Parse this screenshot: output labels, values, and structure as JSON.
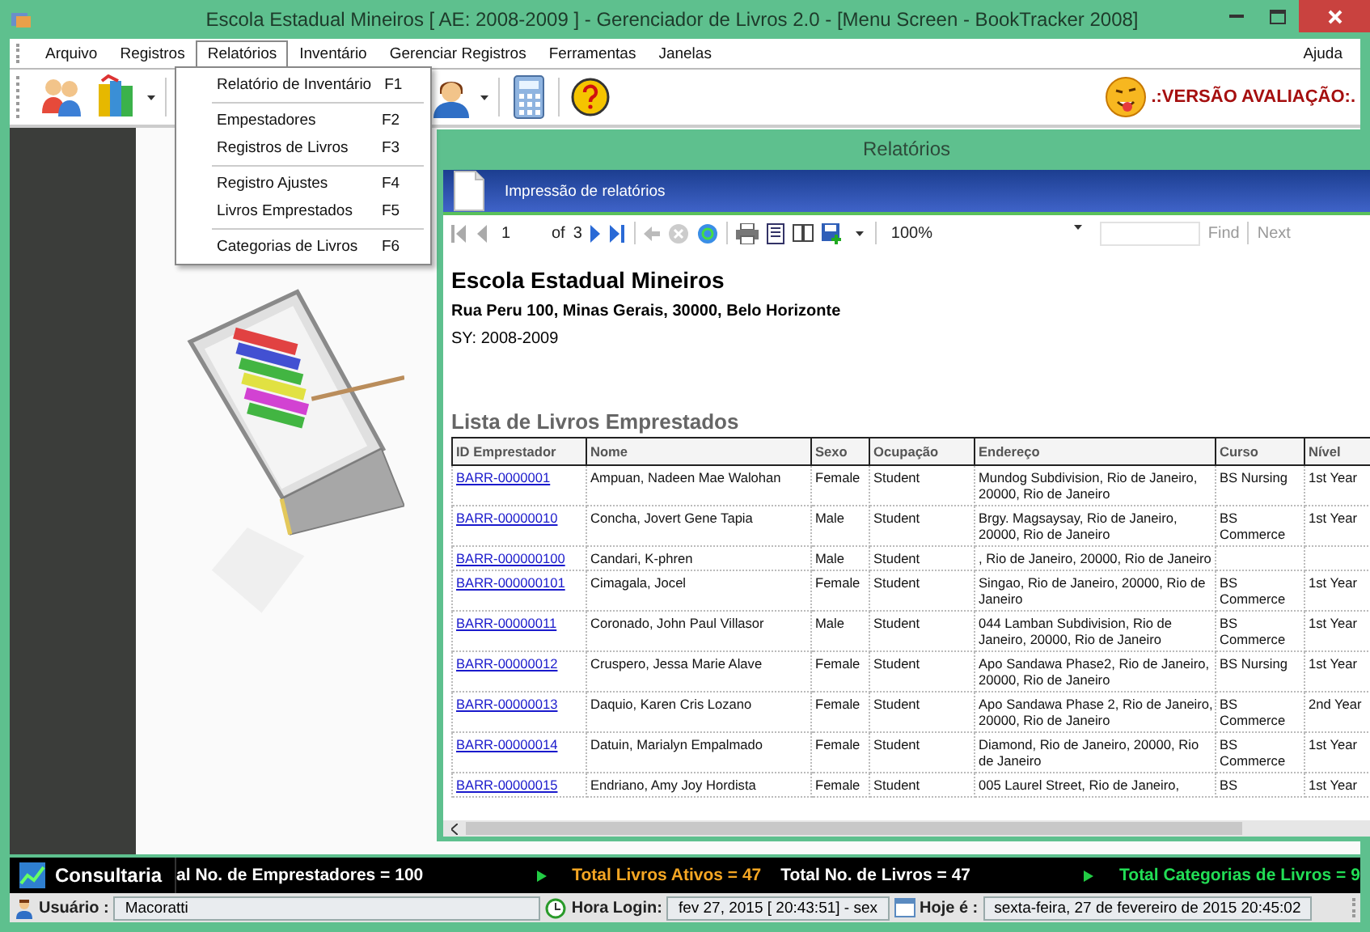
{
  "window": {
    "title": "Escola Estadual Mineiros [ AE: 2008-2009 ] - Gerenciador de Livros 2.0 - [Menu Screen - BookTracker 2008]"
  },
  "menu_bar": {
    "items": [
      {
        "label": "Arquivo",
        "selected": false
      },
      {
        "label": "Registros",
        "selected": false
      },
      {
        "label": "Relatórios",
        "selected": true
      },
      {
        "label": "Inventário",
        "selected": false
      },
      {
        "label": "Gerenciar Registros",
        "selected": false
      },
      {
        "label": "Ferramentas",
        "selected": false
      },
      {
        "label": "Janelas",
        "selected": false
      }
    ],
    "help": "Ajuda"
  },
  "open_menu": {
    "items": [
      {
        "kind": "option",
        "label": "Relatório de Inventário",
        "shortcut": "F1"
      },
      {
        "kind": "separator"
      },
      {
        "kind": "option",
        "label": "Empestadores",
        "shortcut": "F2"
      },
      {
        "kind": "option",
        "label": "Registros de Livros",
        "shortcut": "F3"
      },
      {
        "kind": "separator"
      },
      {
        "kind": "option",
        "label": "Registro Ajustes",
        "shortcut": "F4"
      },
      {
        "kind": "option",
        "label": "Livros Emprestados",
        "shortcut": "F5"
      },
      {
        "kind": "separator"
      },
      {
        "kind": "option",
        "label": "Categorias de Livros",
        "shortcut": "F6"
      }
    ]
  },
  "toolbar": {
    "badge": ".:VERSÃO AVALIAÇÃO:."
  },
  "report_window": {
    "title": "Relatórios",
    "header": "Impressão de relatórios",
    "viewer_toolbar": {
      "page": "1",
      "of": "of",
      "total_pages": "3",
      "zoom": "100%",
      "find": "Find",
      "next": "Next"
    },
    "report": {
      "school": "Escola Estadual Mineiros",
      "address": "Rua Peru 100, Minas Gerais, 30000, Belo Horizonte",
      "school_year": "SY: 2008-2009",
      "list_title": "Lista de Livros Emprestados",
      "columns": [
        "ID Emprestador",
        "Nome",
        "Sexo",
        "Ocupação",
        "Endereço",
        "Curso",
        "Nível"
      ],
      "rows": [
        [
          "BARR-0000001",
          "Ampuan, Nadeen Mae Walohan",
          "Female",
          "Student",
          "Mundog Subdivision, Rio de Janeiro, 20000, Rio de Janeiro",
          "BS Nursing",
          "1st Year"
        ],
        [
          "BARR-00000010",
          "Concha, Jovert Gene Tapia",
          "Male",
          "Student",
          "Brgy. Magsaysay, Rio de Janeiro, 20000, Rio de Janeiro",
          "BS Commerce",
          "1st Year"
        ],
        [
          "BARR-000000100",
          "Candari, K-phren",
          "Male",
          "Student",
          ", Rio de Janeiro, 20000, Rio de Janeiro",
          null,
          null
        ],
        [
          "BARR-000000101",
          "Cimagala, Jocel",
          "Female",
          "Student",
          "Singao, Rio de Janeiro, 20000, Rio de Janeiro",
          "BS Commerce",
          "1st Year"
        ],
        [
          "BARR-00000011",
          "Coronado, John Paul Villasor",
          "Male",
          "Student",
          "044 Lamban Subdivision, Rio de Janeiro, 20000, Rio de Janeiro",
          "BS Commerce",
          "1st Year"
        ],
        [
          "BARR-00000012",
          "Cruspero, Jessa Marie Alave",
          "Female",
          "Student",
          "Apo Sandawa Phase2, Rio de Janeiro, 20000, Rio de Janeiro",
          "BS Nursing",
          "1st Year"
        ],
        [
          "BARR-00000013",
          "Daquio, Karen Cris Lozano",
          "Female",
          "Student",
          "Apo Sandawa Phase 2, Rio de Janeiro, 20000, Rio de Janeiro",
          "BS Commerce",
          "2nd Year"
        ],
        [
          "BARR-00000014",
          "Datuin, Marialyn Empalmado",
          "Female",
          "Student",
          "Diamond, Rio de Janeiro, 20000, Rio de Janeiro",
          "BS Commerce",
          "1st Year"
        ],
        [
          "BARR-00000015",
          "Endriano, Amy Joy Hordista",
          "Female",
          "Student",
          "005 Laurel Street, Rio de Janeiro,",
          "BS",
          "1st Year"
        ]
      ]
    }
  },
  "ticker": {
    "label": "Consultaria",
    "items": [
      {
        "kind": "text",
        "text": "al No. de Emprestadores = 100",
        "color": "#ffffff"
      },
      {
        "kind": "arrow"
      },
      {
        "kind": "text",
        "text": "Total Livros Ativos = 47",
        "color": "#f5a623"
      },
      {
        "kind": "text",
        "text": "Total No. de Livros = 47",
        "color": "#ffffff"
      },
      {
        "kind": "arrow"
      },
      {
        "kind": "text",
        "text": "Total Categorias de Livros = 9",
        "color": "#22dd55"
      }
    ]
  },
  "status_bar": {
    "user_label": "Usuário :",
    "user": "Macoratti",
    "login_label": "Hora Login:",
    "login_time": "fev 27, 2015 [ 20:43:51] - sex",
    "today_label": "Hoje é :",
    "today": "sexta-feira, 27 de fevereiro de 2015  20:45:02"
  }
}
